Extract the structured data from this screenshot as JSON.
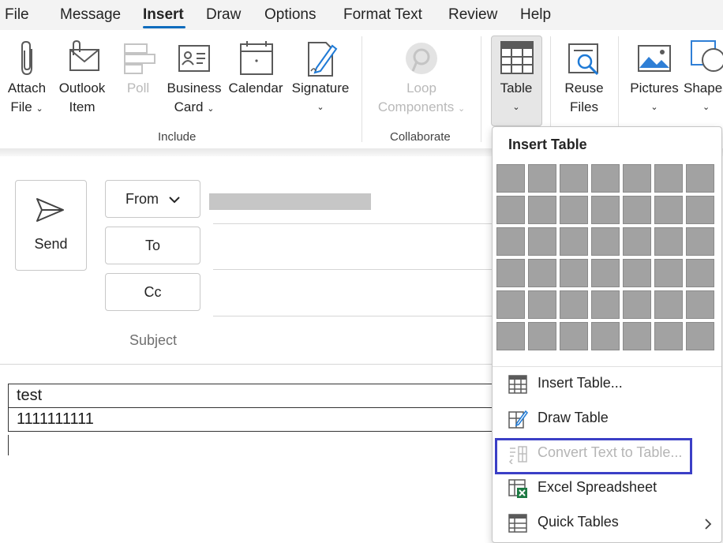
{
  "menu": {
    "tabs": [
      {
        "label": "File",
        "active": false
      },
      {
        "label": "Message",
        "active": false
      },
      {
        "label": "Insert",
        "active": true
      },
      {
        "label": "Draw",
        "active": false
      },
      {
        "label": "Options",
        "active": false
      },
      {
        "label": "Format Text",
        "active": false
      },
      {
        "label": "Review",
        "active": false
      },
      {
        "label": "Help",
        "active": false
      }
    ]
  },
  "ribbon": {
    "attach": {
      "line1": "Attach",
      "line2": "File"
    },
    "outlook_item": {
      "line1": "Outlook",
      "line2": "Item"
    },
    "poll": {
      "line1": "Poll"
    },
    "business_card": {
      "line1": "Business",
      "line2": "Card"
    },
    "calendar": {
      "line1": "Calendar"
    },
    "signature": {
      "line1": "Signature"
    },
    "loop": {
      "line1": "Loop",
      "line2": "Components"
    },
    "table": {
      "line1": "Table"
    },
    "reuse": {
      "line1": "Reuse",
      "line2": "Files"
    },
    "pictures": {
      "line1": "Pictures"
    },
    "shapes": {
      "line1": "Shapes"
    },
    "groups": {
      "include": "Include",
      "collaborate": "Collaborate"
    },
    "accent_color": "#0f6cbd"
  },
  "compose": {
    "send_label": "Send",
    "from_label": "From",
    "to_label": "To",
    "cc_label": "Cc",
    "subject_label": "Subject"
  },
  "body_table": {
    "rows": [
      "test",
      "1111111111"
    ]
  },
  "dropdown": {
    "title": "Insert Table",
    "grid": {
      "cols": 7,
      "rows": 6
    },
    "items": [
      {
        "label": "Insert Table...",
        "disabled": false
      },
      {
        "label": "Draw Table",
        "disabled": false
      },
      {
        "label": "Convert Text to Table...",
        "disabled": true
      },
      {
        "label": "Excel Spreadsheet",
        "disabled": false
      },
      {
        "label": "Quick Tables",
        "disabled": false
      }
    ],
    "focus_color": "#3b3fc6"
  }
}
